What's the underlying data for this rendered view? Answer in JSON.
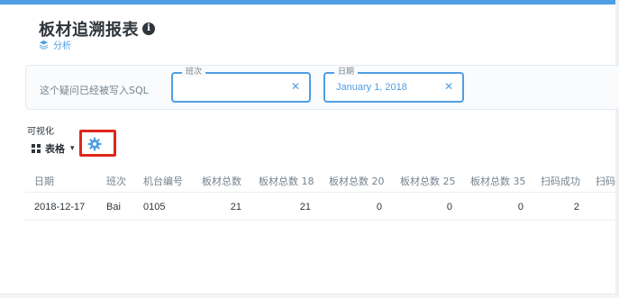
{
  "page": {
    "title": "板材追溯报表",
    "collection": "分析"
  },
  "filters": {
    "note": "这个疑问已经被写入SQL",
    "shift": {
      "label": "班次",
      "value": "",
      "clear_icon": "close-icon"
    },
    "date": {
      "label": "日期",
      "value": "January 1, 2018",
      "clear_icon": "close-icon"
    }
  },
  "visualization": {
    "section_label": "可视化",
    "type_label": "表格",
    "type_icon": "grid-icon",
    "settings_icon": "gear-icon",
    "highlight_color": "#e0261c"
  },
  "table": {
    "columns": [
      "日期",
      "班次",
      "机台编号",
      "板材总数",
      "板材总数 18",
      "板材总数 20",
      "板材总数 25",
      "板材总数 35",
      "扫码成功",
      "扫码"
    ],
    "rows": [
      [
        "2018-12-17",
        "Bai",
        "0105",
        "21",
        "21",
        "0",
        "0",
        "0",
        "2",
        ""
      ]
    ]
  },
  "colors": {
    "accent": "#509ee3",
    "text_dark": "#2e353b",
    "text_muted": "#74838f"
  }
}
